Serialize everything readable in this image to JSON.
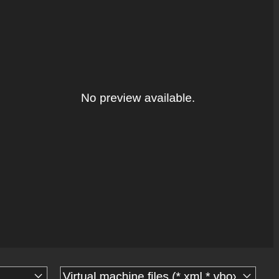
{
  "preview": {
    "message": "No preview available."
  },
  "footer": {
    "name_dropdown": {
      "value": ""
    },
    "filetype_dropdown": {
      "value": "Virtual machine files (*.xml,*.vbox)"
    }
  },
  "icons": {
    "chevron": "chevron-down-icon"
  }
}
